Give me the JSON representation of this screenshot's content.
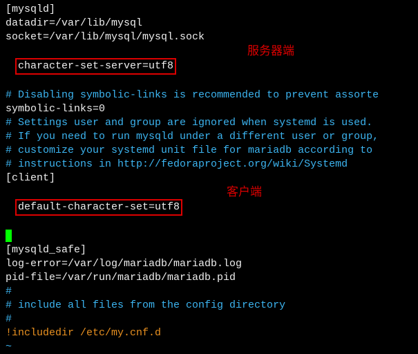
{
  "lines": {
    "l1": "[mysqld]",
    "l2": "datadir=/var/lib/mysql",
    "l3": "socket=/var/lib/mysql/mysql.sock",
    "l4": "character-set-server=utf8",
    "l5": "# Disabling symbolic-links is recommended to prevent assorte",
    "l6": "symbolic-links=0",
    "l7": "# Settings user and group are ignored when systemd is used.",
    "l8": "# If you need to run mysqld under a different user or group,",
    "l9": "# customize your systemd unit file for mariadb according to ",
    "l10": "# instructions in http://fedoraproject.org/wiki/Systemd",
    "l11": "",
    "l12": "[client]",
    "l13": "default-character-set=utf8",
    "l14": "",
    "l15": "[mysqld_safe]",
    "l16": "log-error=/var/log/mariadb/mariadb.log",
    "l17": "pid-file=/var/run/mariadb/mariadb.pid",
    "l18": "",
    "l19": "#",
    "l20": "# include all files from the config directory",
    "l21": "#",
    "l22": "!includedir /etc/my.cnf.d",
    "l23": "",
    "l24": "~"
  },
  "annotations": {
    "server": "服务器端",
    "client": "客户端"
  }
}
